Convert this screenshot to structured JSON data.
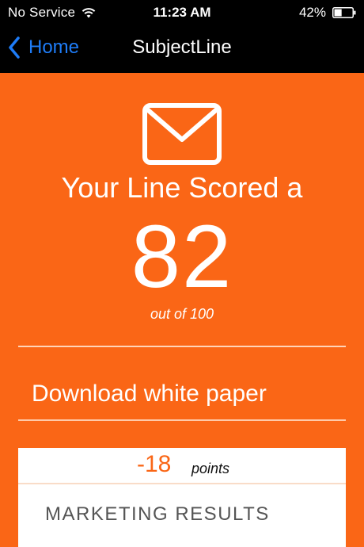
{
  "status_bar": {
    "carrier": "No Service",
    "time": "11:23 AM",
    "battery": "42%",
    "battery_level": 0.42,
    "wifi_icon": "wifi-icon",
    "battery_icon": "battery-icon"
  },
  "nav": {
    "back_label": "Home",
    "title": "SubjectLine",
    "back_icon": "chevron-left-icon",
    "accent_color": "#1e7cf7"
  },
  "score": {
    "icon": "envelope-icon",
    "heading": "Your Line Scored a",
    "value": "82",
    "out_of": "out of 100"
  },
  "download": {
    "label": "Download white paper"
  },
  "results": {
    "points_value": "-18",
    "points_label": "points",
    "title": "MARKETING RESULTS"
  },
  "colors": {
    "brand": "#fa6616",
    "text_on_brand": "#ffffff",
    "nav_background": "#000000"
  }
}
